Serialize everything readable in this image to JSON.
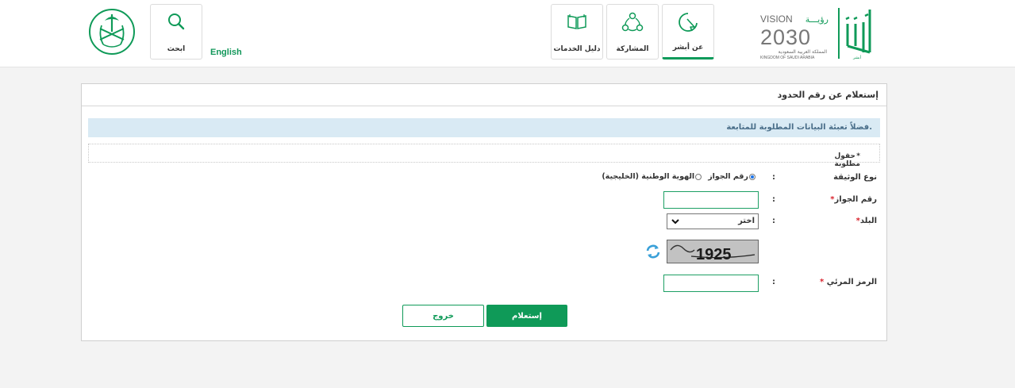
{
  "header": {
    "search_label": "ابحث",
    "english_label": "English",
    "tiles": [
      {
        "label": "دليل الخدمات",
        "icon": "book-icon"
      },
      {
        "label": "المشاركة",
        "icon": "share-icon"
      },
      {
        "label": "عن أبشر",
        "icon": "pointer-icon"
      }
    ],
    "vision": {
      "word": "VISION",
      "year": "2030",
      "arabic": "رؤيـــة",
      "ksa_ar": "المملكة العربية السعودية",
      "ksa_en": "KINGDOM OF SAUDI ARABIA"
    },
    "absher_logo_text": "أبشر"
  },
  "form": {
    "title": "إستعلام عن رقم الحدود",
    "info_message": "فضلاً تعبئة البيانات المطلوبة للمتابعة.",
    "required_star": "*",
    "required_note": "حقول مطلوبة",
    "colon": ":",
    "doc_type_label": "نوع الوثيقة",
    "doc_type_options": [
      "رقم الجواز",
      "الهوية الوطنية (الخليجية)"
    ],
    "passport_label": "رقم الجواز",
    "country_label": "البلد",
    "country_selected": "اختر",
    "captcha_text": "1925",
    "captcha_label": "الرمز المرئي",
    "submit_label": "إستعلام",
    "exit_label": "خروج"
  },
  "colors": {
    "brand_green": "#0f9a58",
    "info_bg": "#d9eaf4",
    "required_red": "#d9232d"
  }
}
